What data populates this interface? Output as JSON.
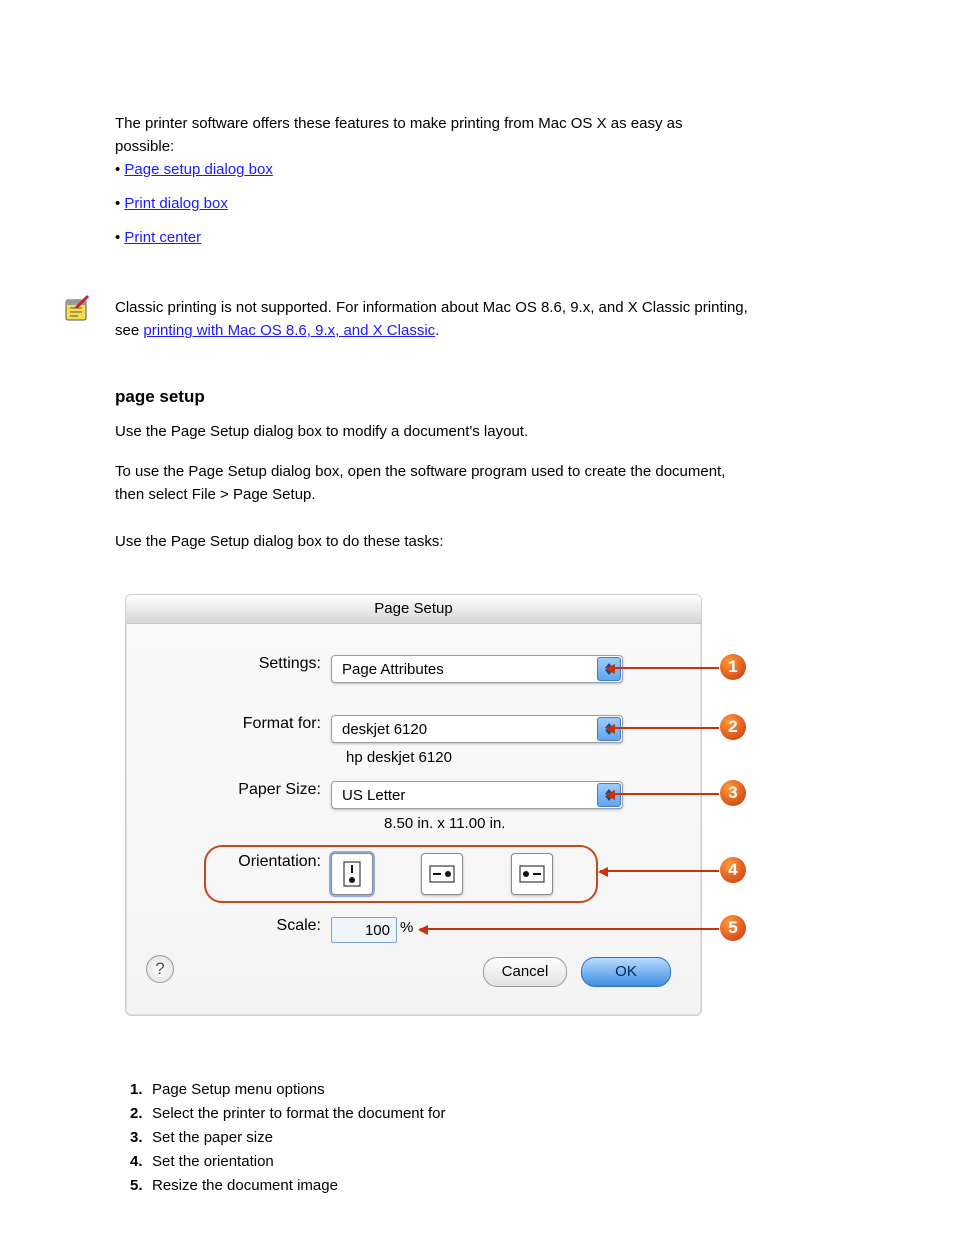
{
  "doc": {
    "intro": "The printer software offers these features to make printing from Mac OS X as easy as possible:",
    "links": {
      "page_setup": "Page setup dialog box",
      "print_dialog": "Print dialog box",
      "print_center": "Print center"
    },
    "note_pre": "Classic printing is not supported. For information about Mac OS 8.6, 9.x, and X Classic printing, see ",
    "note_link": "printing with Mac OS 8.6, 9.x, and X Classic",
    "note_post": ".",
    "heading": "page setup",
    "para": "Use the Page Setup dialog box to modify a document's layout.",
    "steps1": "To use the Page Setup dialog box, open the software program used to create the document, then select File > Page Setup.",
    "steps2": "Use the Page Setup dialog box to do these tasks:"
  },
  "dialog": {
    "title": "Page Setup",
    "settings": {
      "label": "Settings:",
      "value": "Page Attributes"
    },
    "format": {
      "label": "Format for:",
      "value": "deskjet 6120",
      "sub": "hp deskjet 6120"
    },
    "paper": {
      "label": "Paper Size:",
      "value": "US Letter",
      "sub": "8.50 in. x 11.00 in."
    },
    "orient": {
      "label": "Orientation:"
    },
    "scale": {
      "label": "Scale:",
      "value": "100",
      "pct": "%"
    },
    "cancel": "Cancel",
    "ok": "OK"
  },
  "callouts": {
    "1": "Page Setup menu options",
    "2": "Select the printer to format the document for",
    "3": "Set the paper size",
    "4": "Set the orientation",
    "5": "Resize the document image"
  }
}
